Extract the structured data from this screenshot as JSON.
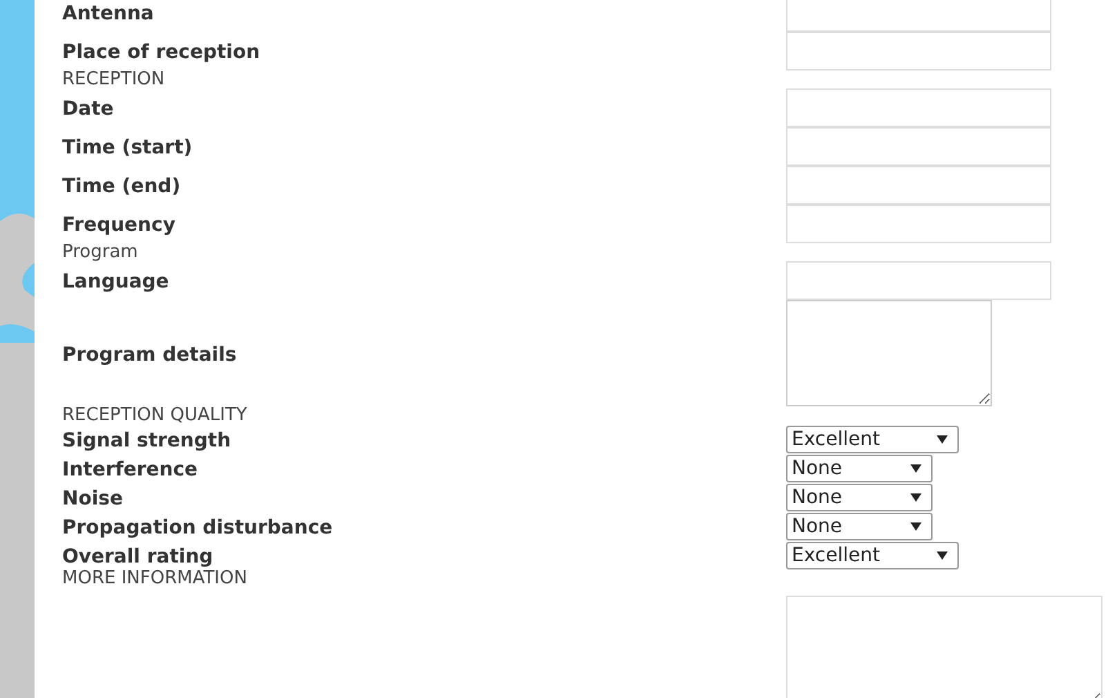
{
  "form": {
    "rows": [
      {
        "kind": "input",
        "label": "Antenna"
      },
      {
        "kind": "input",
        "label": "Place of reception"
      },
      {
        "kind": "heading",
        "label": "RECEPTION"
      },
      {
        "kind": "input",
        "label": "Date"
      },
      {
        "kind": "input",
        "label": "Time (start)"
      },
      {
        "kind": "input",
        "label": "Time (end)"
      },
      {
        "kind": "input",
        "label": "Frequency"
      },
      {
        "kind": "heading",
        "label": "Program"
      },
      {
        "kind": "input",
        "label": "Language"
      },
      {
        "kind": "textarea",
        "label": "Program details"
      },
      {
        "kind": "heading",
        "label": "RECEPTION QUALITY"
      },
      {
        "kind": "select",
        "label": "Signal strength",
        "value": "Excellent"
      },
      {
        "kind": "select",
        "label": "Interference",
        "value": "None"
      },
      {
        "kind": "select",
        "label": "Noise",
        "value": "None"
      },
      {
        "kind": "select",
        "label": "Propagation disturbance",
        "value": "None"
      },
      {
        "kind": "select",
        "label": "Overall rating",
        "value": "Excellent"
      },
      {
        "kind": "heading",
        "label": "MORE INFORMATION"
      },
      {
        "kind": "bigtext"
      }
    ]
  }
}
